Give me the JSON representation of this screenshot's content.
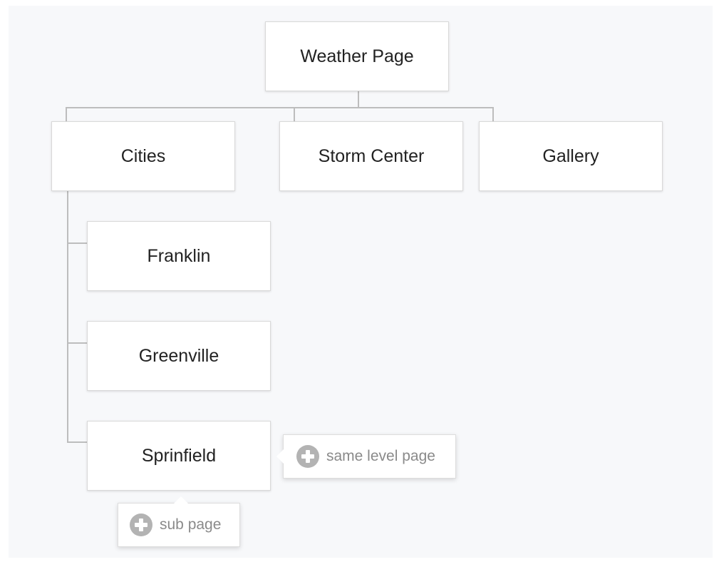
{
  "sitemap": {
    "root": {
      "label": "Weather Page"
    },
    "level1": [
      {
        "label": "Cities"
      },
      {
        "label": "Storm Center"
      },
      {
        "label": "Gallery"
      }
    ],
    "cities_children": [
      {
        "label": "Franklin"
      },
      {
        "label": "Greenville"
      },
      {
        "label": "Sprinfield"
      }
    ]
  },
  "actions": {
    "same_level": {
      "label": "same level page",
      "icon": "plus-circle-icon"
    },
    "sub_page": {
      "label": "sub page",
      "icon": "plus-circle-icon"
    }
  },
  "colors": {
    "canvas_background": "#f7f8fa",
    "card_background": "#ffffff",
    "connector": "#bdbdbd",
    "icon": "#b3b3b3",
    "action_text": "#8a8a8a"
  }
}
